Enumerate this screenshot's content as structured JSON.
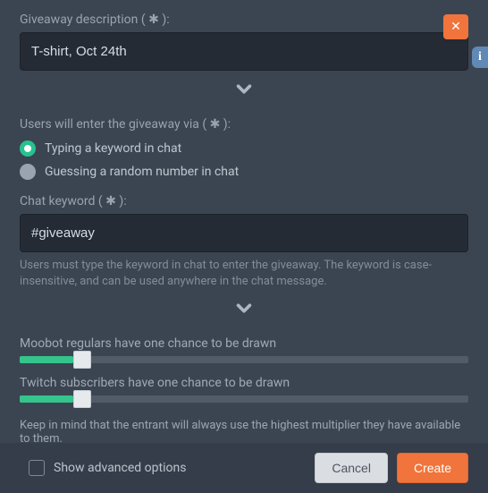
{
  "close": "✕",
  "info": "i",
  "description": {
    "label": "Giveaway description ( ✱ ):",
    "value": "T-shirt, Oct 24th"
  },
  "entry": {
    "label": "Users will enter the giveaway via ( ✱ ):",
    "options": [
      {
        "label": "Typing a keyword in chat",
        "selected": true
      },
      {
        "label": "Guessing a random number in chat",
        "selected": false
      }
    ]
  },
  "keyword": {
    "label": "Chat keyword ( ✱ ):",
    "value": "#giveaway",
    "help": "Users must type the keyword in chat to enter the giveaway. The keyword is case-insensitive, and can be used anywhere in the chat message."
  },
  "sliders": {
    "regulars": {
      "label": "Moobot regulars have one chance to be drawn",
      "percent": 12
    },
    "subs": {
      "label": "Twitch subscribers have one chance to be drawn",
      "percent": 12
    },
    "note": "Keep in mind that the entrant will always use the highest multiplier they have available to them."
  },
  "footer": {
    "advanced": "Show advanced options",
    "cancel": "Cancel",
    "create": "Create"
  }
}
